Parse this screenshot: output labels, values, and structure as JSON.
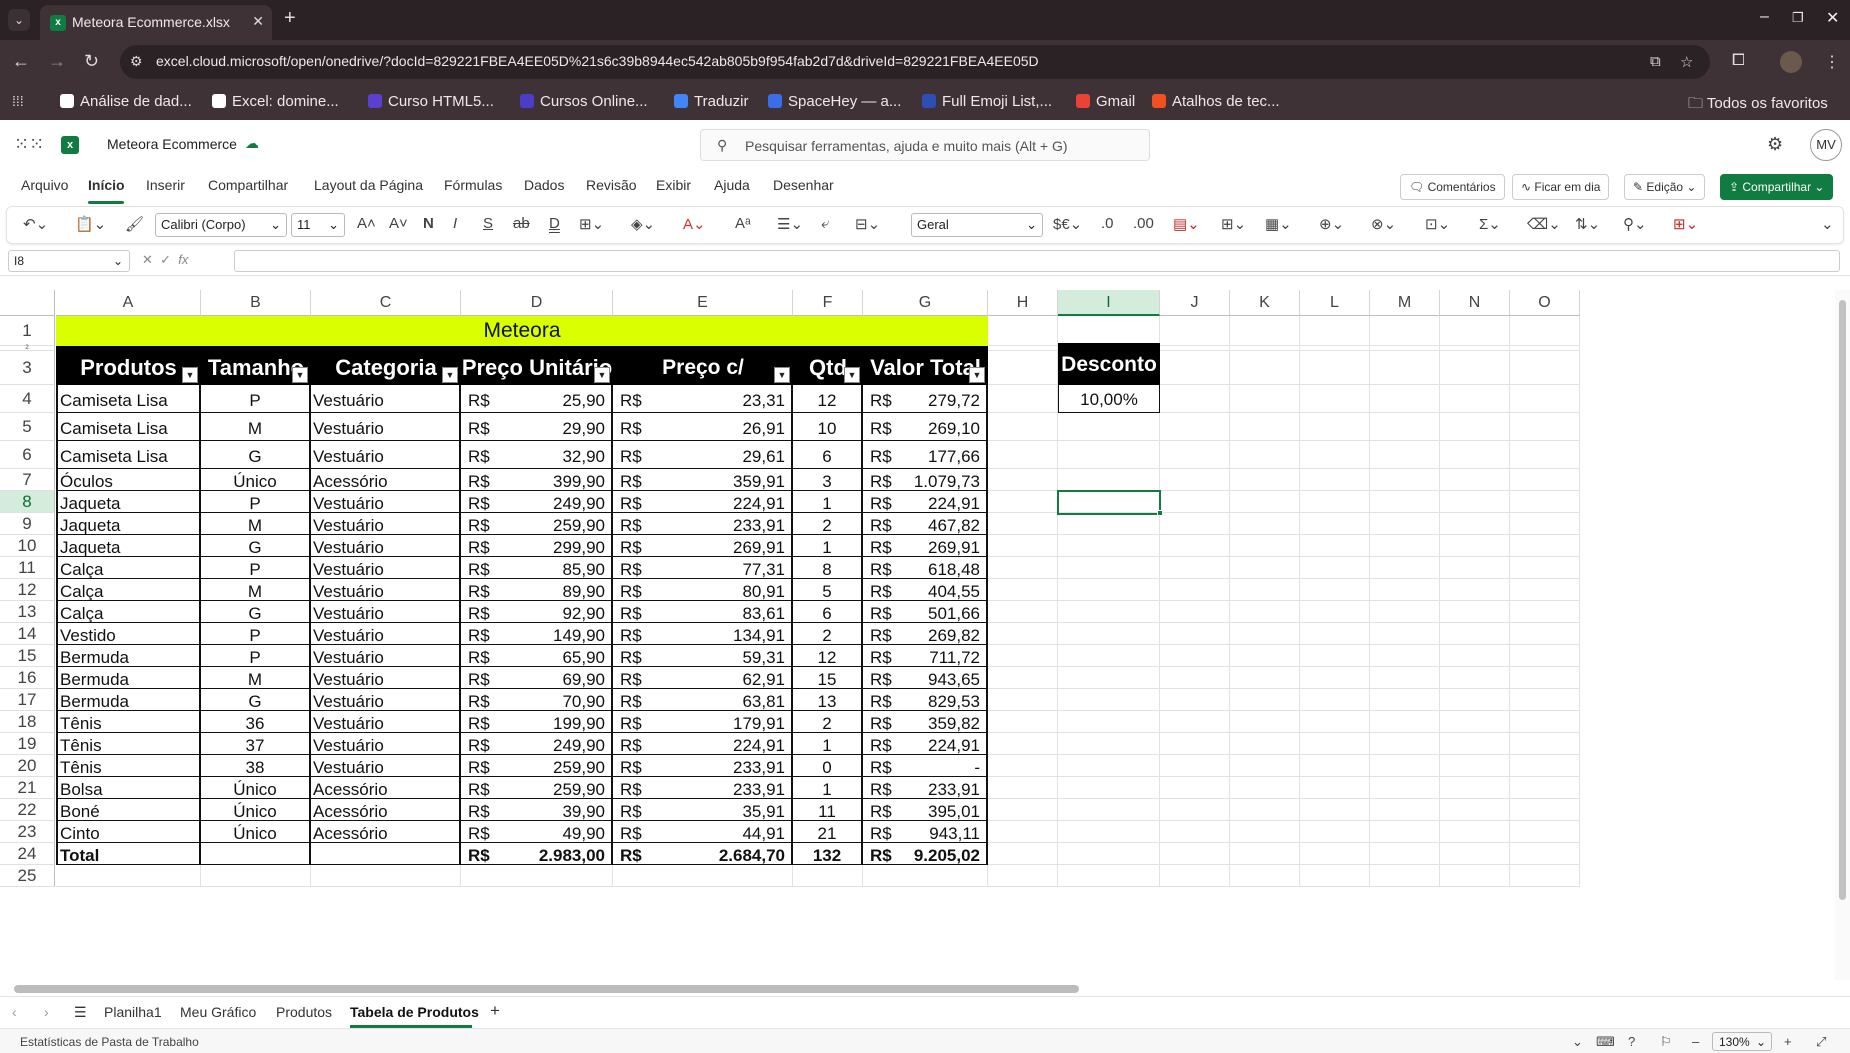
{
  "browser": {
    "tab_title": "Meteora Ecommerce.xlsx",
    "url": "excel.cloud.microsoft/open/onedrive/?docId=829221FBEA4EE05D%21s6c39b8944ec542ab805b9f954fab2d7d&driveId=829221FBEA4EE05D",
    "bookmarks": [
      "Análise de dad...",
      "Excel: domine...",
      "Curso HTML5...",
      "Cursos Online...",
      "Traduzir",
      "SpaceHey — a...",
      "Full Emoji List,...",
      "Gmail",
      "Atalhos de tec..."
    ],
    "all_bookmarks": "Todos os favoritos"
  },
  "app": {
    "doc_title": "Meteora Ecommerce",
    "search_placeholder": "Pesquisar ferramentas, ajuda e muito mais (Alt + G)",
    "user_initials": "MV",
    "ribbon_tabs": [
      "Arquivo",
      "Início",
      "Inserir",
      "Compartilhar",
      "Layout da Página",
      "Fórmulas",
      "Dados",
      "Revisão",
      "Exibir",
      "Ajuda",
      "Desenhar"
    ],
    "active_ribbon_tab": "Início",
    "buttons": {
      "comments": "Comentários",
      "catch_up": "Ficar em dia",
      "editing": "Edição",
      "share": "Compartilhar"
    },
    "font_name": "Calibri (Corpo)",
    "font_size": "11",
    "number_format": "Geral",
    "name_box": "I8",
    "accent_color": "#107c41"
  },
  "grid": {
    "columns": [
      "A",
      "B",
      "C",
      "D",
      "E",
      "F",
      "G",
      "H",
      "I",
      "J",
      "K",
      "L",
      "M",
      "N",
      "O"
    ],
    "selected_column": "I",
    "selected_row": "8",
    "row_numbers": [
      "1",
      "2",
      "3",
      "4",
      "5",
      "6",
      "7",
      "8",
      "9",
      "10",
      "11",
      "12",
      "13",
      "14",
      "15",
      "16",
      "17",
      "18",
      "19",
      "20",
      "21",
      "22",
      "23",
      "24",
      "25"
    ],
    "title": "Meteora",
    "title_color": "#d9ff00",
    "headers": [
      "Produtos",
      "Tamanho",
      "Categoria",
      "Preço Unitário",
      "Preço c/ Desconto",
      "Qtd",
      "Valor Total"
    ],
    "currency": "R$",
    "rows": [
      [
        "Camiseta Lisa",
        "P",
        "Vestuário",
        "25,90",
        "23,31",
        "12",
        "279,72"
      ],
      [
        "Camiseta Lisa",
        "M",
        "Vestuário",
        "29,90",
        "26,91",
        "10",
        "269,10"
      ],
      [
        "Camiseta Lisa",
        "G",
        "Vestuário",
        "32,90",
        "29,61",
        "6",
        "177,66"
      ],
      [
        "Óculos",
        "Único",
        "Acessório",
        "399,90",
        "359,91",
        "3",
        "1.079,73"
      ],
      [
        "Jaqueta",
        "P",
        "Vestuário",
        "249,90",
        "224,91",
        "1",
        "224,91"
      ],
      [
        "Jaqueta",
        "M",
        "Vestuário",
        "259,90",
        "233,91",
        "2",
        "467,82"
      ],
      [
        "Jaqueta",
        "G",
        "Vestuário",
        "299,90",
        "269,91",
        "1",
        "269,91"
      ],
      [
        "Calça",
        "P",
        "Vestuário",
        "85,90",
        "77,31",
        "8",
        "618,48"
      ],
      [
        "Calça",
        "M",
        "Vestuário",
        "89,90",
        "80,91",
        "5",
        "404,55"
      ],
      [
        "Calça",
        "G",
        "Vestuário",
        "92,90",
        "83,61",
        "6",
        "501,66"
      ],
      [
        "Vestido",
        "P",
        "Vestuário",
        "149,90",
        "134,91",
        "2",
        "269,82"
      ],
      [
        "Bermuda",
        "P",
        "Vestuário",
        "65,90",
        "59,31",
        "12",
        "711,72"
      ],
      [
        "Bermuda",
        "M",
        "Vestuário",
        "69,90",
        "62,91",
        "15",
        "943,65"
      ],
      [
        "Bermuda",
        "G",
        "Vestuário",
        "70,90",
        "63,81",
        "13",
        "829,53"
      ],
      [
        "Tênis",
        "36",
        "Vestuário",
        "199,90",
        "179,91",
        "2",
        "359,82"
      ],
      [
        "Tênis",
        "37",
        "Vestuário",
        "249,90",
        "224,91",
        "1",
        "224,91"
      ],
      [
        "Tênis",
        "38",
        "Vestuário",
        "259,90",
        "233,91",
        "0",
        "-"
      ],
      [
        "Bolsa",
        "Único",
        "Acessório",
        "259,90",
        "233,91",
        "1",
        "233,91"
      ],
      [
        "Boné",
        "Único",
        "Acessório",
        "39,90",
        "35,91",
        "11",
        "395,01"
      ],
      [
        "Cinto",
        "Único",
        "Acessório",
        "49,90",
        "44,91",
        "21",
        "943,11"
      ]
    ],
    "total": [
      "Total",
      "",
      "",
      "2.983,00",
      "2.684,70",
      "132",
      "9.205,02"
    ],
    "discount_label": "Desconto",
    "discount_value": "10,00%"
  },
  "sheets": {
    "tabs": [
      "Planilha1",
      "Meu Gráfico",
      "Produtos",
      "Tabela de Produtos"
    ],
    "active": "Tabela de Produtos"
  },
  "status": {
    "text": "Estatísticas de Pasta de Trabalho",
    "zoom": "130%"
  }
}
